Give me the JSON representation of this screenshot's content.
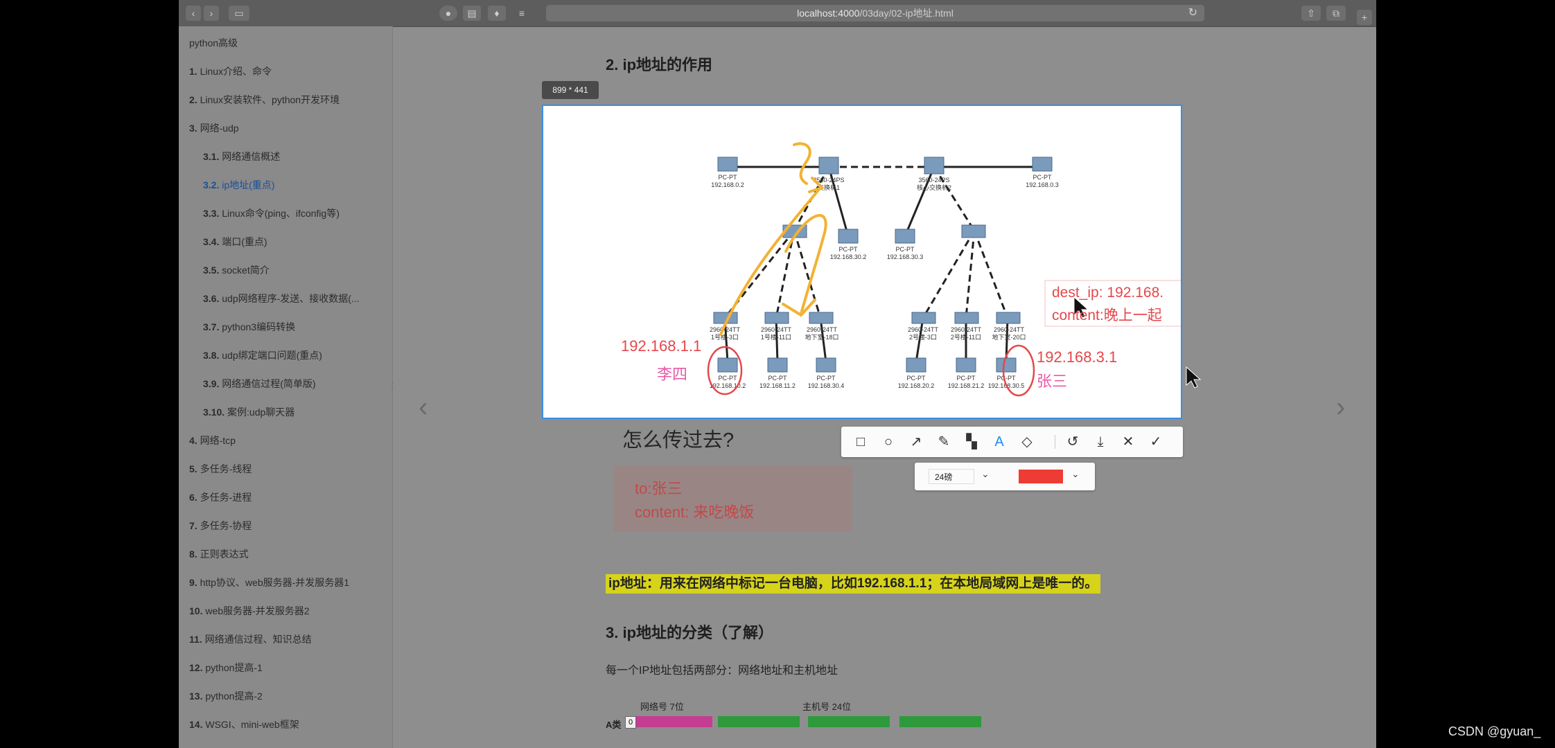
{
  "browser": {
    "url_host": "localhost:4000",
    "url_path": "/03day/02-ip地址.html"
  },
  "sidebar": {
    "title": "python高级",
    "items": [
      {
        "num": "1.",
        "label": "Linux介绍、命令"
      },
      {
        "num": "2.",
        "label": "Linux安装软件、python开发环境"
      },
      {
        "num": "3.",
        "label": "网络-udp"
      },
      {
        "num": "3.1.",
        "label": "网络通信概述"
      },
      {
        "num": "3.2.",
        "label": "ip地址(重点)"
      },
      {
        "num": "3.3.",
        "label": "Linux命令(ping、ifconfig等)"
      },
      {
        "num": "3.4.",
        "label": "端口(重点)"
      },
      {
        "num": "3.5.",
        "label": "socket简介"
      },
      {
        "num": "3.6.",
        "label": "udp网络程序-发送、接收数据(..."
      },
      {
        "num": "3.7.",
        "label": "python3编码转换"
      },
      {
        "num": "3.8.",
        "label": "udp绑定端口问题(重点)"
      },
      {
        "num": "3.9.",
        "label": "网络通信过程(简单版)"
      },
      {
        "num": "3.10.",
        "label": "案例:udp聊天器"
      },
      {
        "num": "4.",
        "label": "网络-tcp"
      },
      {
        "num": "5.",
        "label": "多任务-线程"
      },
      {
        "num": "6.",
        "label": "多任务-进程"
      },
      {
        "num": "7.",
        "label": "多任务-协程"
      },
      {
        "num": "8.",
        "label": "正则表达式"
      },
      {
        "num": "9.",
        "label": "http协议、web服务器-并发服务器1"
      },
      {
        "num": "10.",
        "label": "web服务器-并发服务器2"
      },
      {
        "num": "11.",
        "label": "网络通信过程、知识总结"
      },
      {
        "num": "12.",
        "label": "python提高-1"
      },
      {
        "num": "13.",
        "label": "python提高-2"
      },
      {
        "num": "14.",
        "label": "WSGI、mini-web框架"
      }
    ]
  },
  "content": {
    "section2_title": "2. ip地址的作用",
    "capture_size": "899 * 441",
    "question": "怎么传过去?",
    "msg_to": "to:张三",
    "msg_content": "content:  来吃晚饭",
    "highlight": "ip地址：用来在网络中标记一台电脑，比如192.168.1.1；在本地局域网上是唯一的。",
    "section3_title": "3. ip地址的分类（了解）",
    "para": "每一个IP地址包括两部分：网络地址和主机地址",
    "ipbar": {
      "class_label": "A类",
      "net_label": "网络号 7位",
      "host_label": "主机号 24位",
      "zero": "0"
    }
  },
  "diagram": {
    "devices": [
      {
        "label": "PC-PT",
        "ip": "192.168.0.2"
      },
      {
        "label": "3560-24PS",
        "ip": "交换机1"
      },
      {
        "label": "3560-24PS",
        "ip": "核心交换机2"
      },
      {
        "label": "PC-PT",
        "ip": "192.168.0.3"
      },
      {
        "label": "PC-PT",
        "ip": "192.168.30.2"
      },
      {
        "label": "PC-PT",
        "ip": "192.168.30.3"
      },
      {
        "label": "2960-24TT",
        "ip": "1号楼-3口"
      },
      {
        "label": "2960-24TT",
        "ip": "1号楼-11口"
      },
      {
        "label": "2960-24TT",
        "ip": "地下室-18口"
      },
      {
        "label": "2960-24TT",
        "ip": "2号楼-3口"
      },
      {
        "label": "2960-24TT",
        "ip": "2号楼-11口"
      },
      {
        "label": "2960-24TT",
        "ip": "地下室-20口"
      },
      {
        "label": "PC-PT",
        "ip": "192.168.10.2"
      },
      {
        "label": "PC-PT",
        "ip": "192.168.11.2"
      },
      {
        "label": "PC-PT",
        "ip": "192.168.30.4"
      },
      {
        "label": "PC-PT",
        "ip": "192.168.20.2"
      },
      {
        "label": "PC-PT",
        "ip": "192.168.21.2"
      },
      {
        "label": "PC-PT",
        "ip": "192.168.30.5"
      }
    ],
    "ann_ip_left": "192.168.1.1",
    "ann_name_left": "李四",
    "ann_ip_right": "192.168.3.1",
    "ann_name_right": "张三",
    "ann_dest_ip": "dest_ip: 192.168.",
    "ann_dest_content": "content:晚上一起"
  },
  "annotation_toolbar": {
    "font_size": "24磅",
    "color": "#ee3c35",
    "tools": [
      "rectangle-icon",
      "ellipse-icon",
      "arrow-icon",
      "pencil-icon",
      "mosaic-icon",
      "text-icon",
      "eraser-icon",
      "undo-icon",
      "download-icon",
      "close-icon",
      "check-icon"
    ]
  },
  "watermark": "CSDN @gyuan_"
}
